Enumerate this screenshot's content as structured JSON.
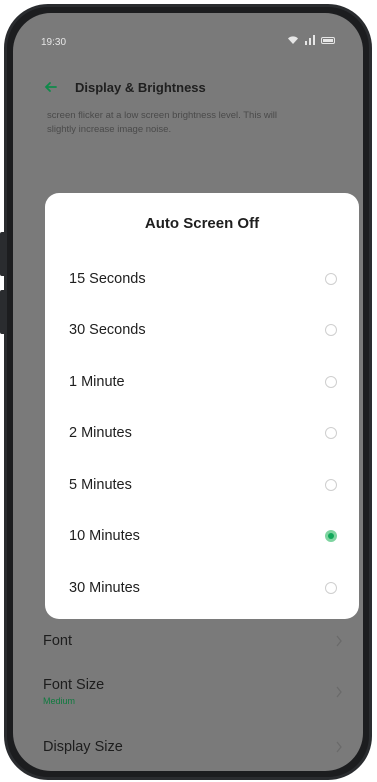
{
  "status_bar": {
    "time": "19:30",
    "icons": [
      "wifi-icon",
      "signal-icon",
      "battery-icon"
    ]
  },
  "header": {
    "title": "Display & Brightness",
    "back_icon": "back-arrow-icon"
  },
  "background_text": "screen flicker at a low screen brightness level. This will slightly increase image noise.",
  "dialog": {
    "title": "Auto Screen Off",
    "options": [
      {
        "label": "15 Seconds",
        "selected": false
      },
      {
        "label": "30 Seconds",
        "selected": false
      },
      {
        "label": "1 Minute",
        "selected": false
      },
      {
        "label": "2 Minutes",
        "selected": false
      },
      {
        "label": "5 Minutes",
        "selected": false
      },
      {
        "label": "10 Minutes",
        "selected": true
      },
      {
        "label": "30 Minutes",
        "selected": false
      }
    ]
  },
  "settings": {
    "font_label": "Font",
    "font_size_label": "Font Size",
    "font_size_value": "Medium",
    "display_size_label": "Display Size"
  },
  "colors": {
    "accent": "#10a85a",
    "scrim": "#7a7a7a",
    "dialog_bg": "#ffffff"
  }
}
